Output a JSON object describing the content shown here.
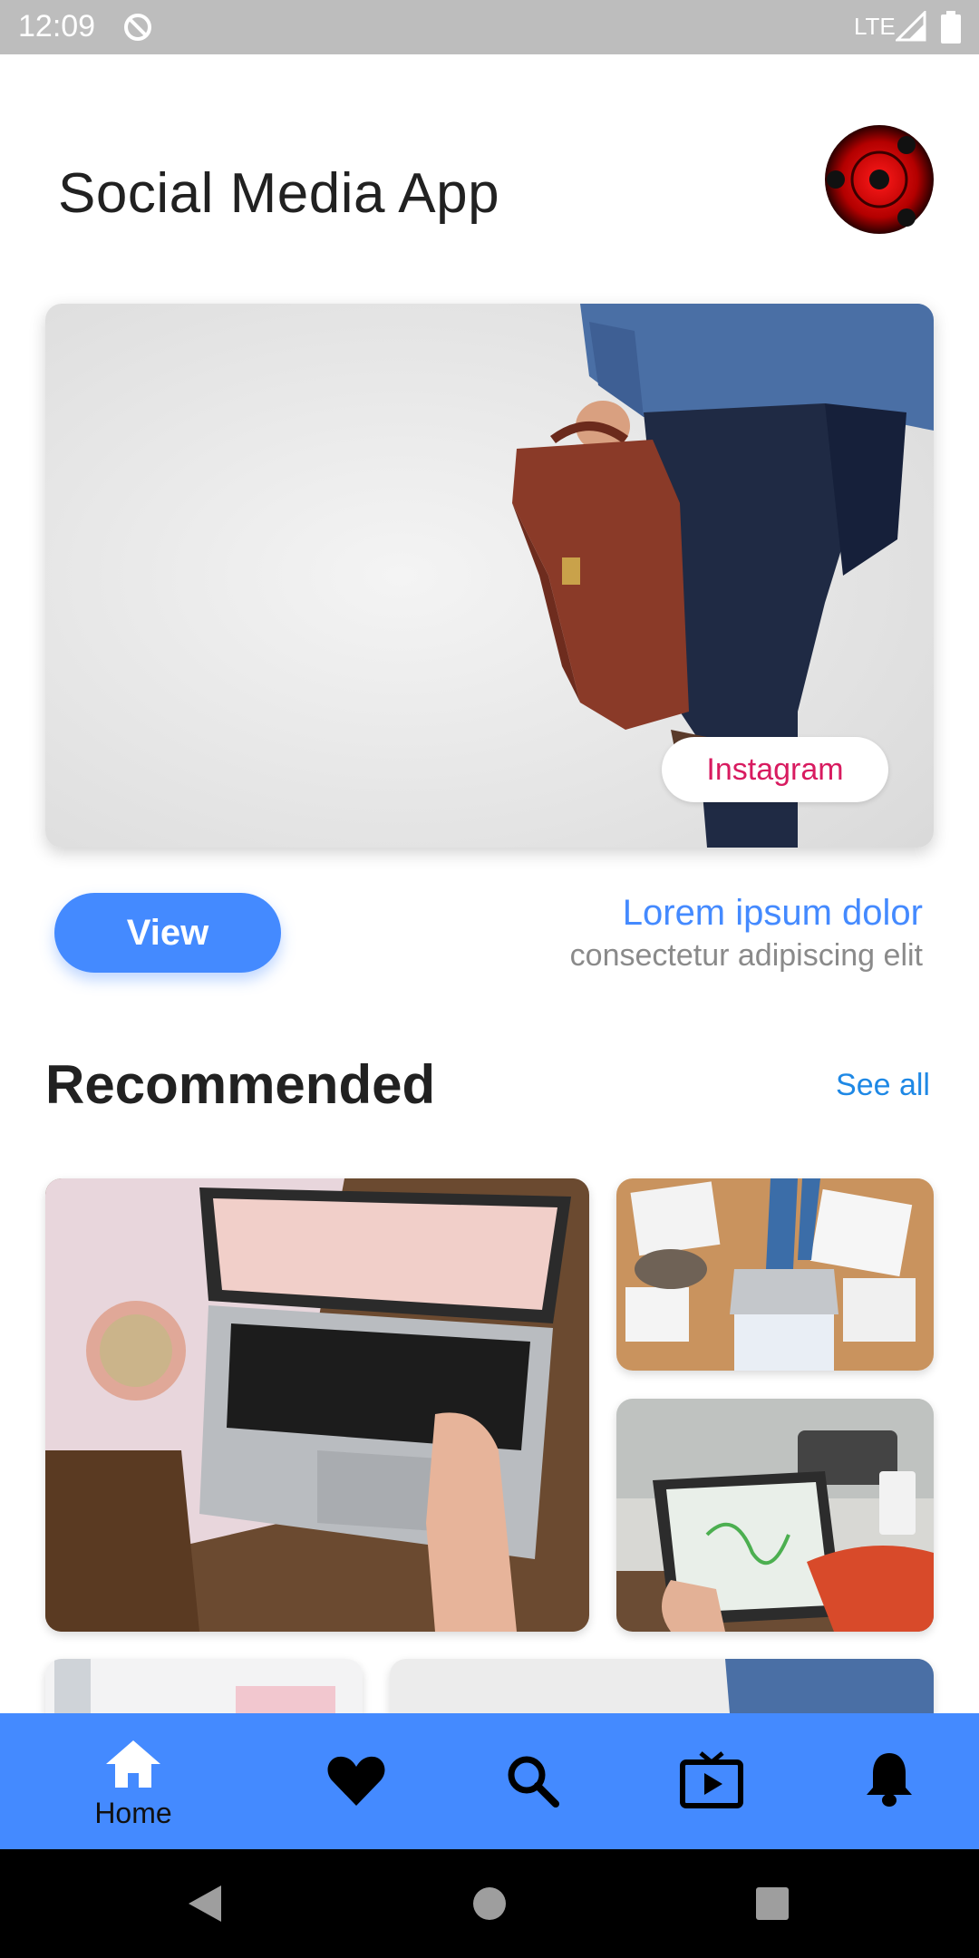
{
  "status_bar": {
    "time": "12:09",
    "network": "LTE",
    "icons": [
      "sync-icon",
      "signal-icon",
      "battery-icon"
    ]
  },
  "header": {
    "title": "Social Media App",
    "avatar": "avatar-icon"
  },
  "hero": {
    "image": "businessman-with-briefcase-photo",
    "chip_label": "Instagram"
  },
  "actions": {
    "view_label": "View",
    "caption_title": "Lorem ipsum dolor",
    "caption_subtitle": "consectetur adipiscing elit"
  },
  "recommended": {
    "title": "Recommended",
    "see_all": "See all",
    "tiles": [
      "laptop-desk-photo",
      "office-desk-photo",
      "tablet-drawing-photo"
    ]
  },
  "bottom_nav": {
    "items": [
      {
        "icon": "home-icon",
        "label": "Home",
        "active": true
      },
      {
        "icon": "heart-icon"
      },
      {
        "icon": "search-icon"
      },
      {
        "icon": "tv-icon"
      },
      {
        "icon": "bell-icon"
      }
    ]
  },
  "colors": {
    "accent": "#448aff",
    "link": "#1e88e5",
    "chip_text": "#d81b60",
    "status_bar": "#bdbdbd"
  },
  "system_nav": [
    "back-icon",
    "home-circle-icon",
    "recents-icon"
  ]
}
